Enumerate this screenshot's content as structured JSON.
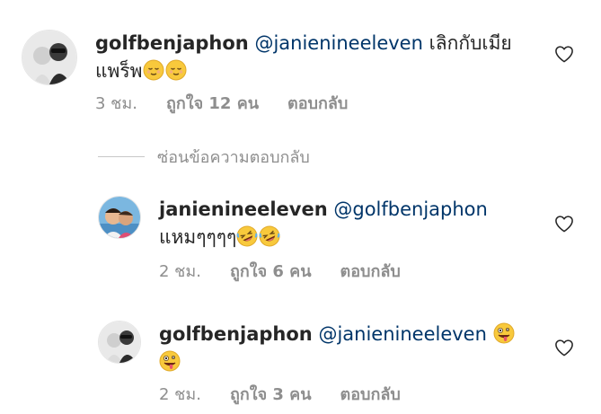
{
  "comments": [
    {
      "username": "golfbenjaphon",
      "mention": "@janienineeleven",
      "text": " เลิกกับเมีย แพร็พ",
      "emojis": [
        "relieved-face",
        "relieved-face"
      ],
      "time": "3 ชม.",
      "likes": "ถูกใจ 12 คน",
      "reply": "ตอบกลับ"
    },
    {
      "username": "janienineeleven",
      "mention": "@golfbenjaphon",
      "text": " แหมๆๆๆๆ",
      "emojis": [
        "rolling-on-floor-laughing",
        "rolling-on-floor-laughing"
      ],
      "time": "2 ชม.",
      "likes": "ถูกใจ 6 คน",
      "reply": "ตอบกลับ"
    },
    {
      "username": "golfbenjaphon",
      "mention": "@janienineeleven",
      "text": " ",
      "emojis": [
        "zany-face",
        "zany-face"
      ],
      "time": "2 ชม.",
      "likes": "ถูกใจ 3 คน",
      "reply": "ตอบกลับ"
    }
  ],
  "hide_replies_label": "ซ่อนข้อความตอบกลับ",
  "colors": {
    "text": "#262626",
    "mention": "#003569",
    "meta": "#8e8e8e",
    "divider": "#c7c7c7",
    "emoji_yellow": "#f8c93c"
  },
  "icons": {
    "like": "heart-outline-icon"
  }
}
